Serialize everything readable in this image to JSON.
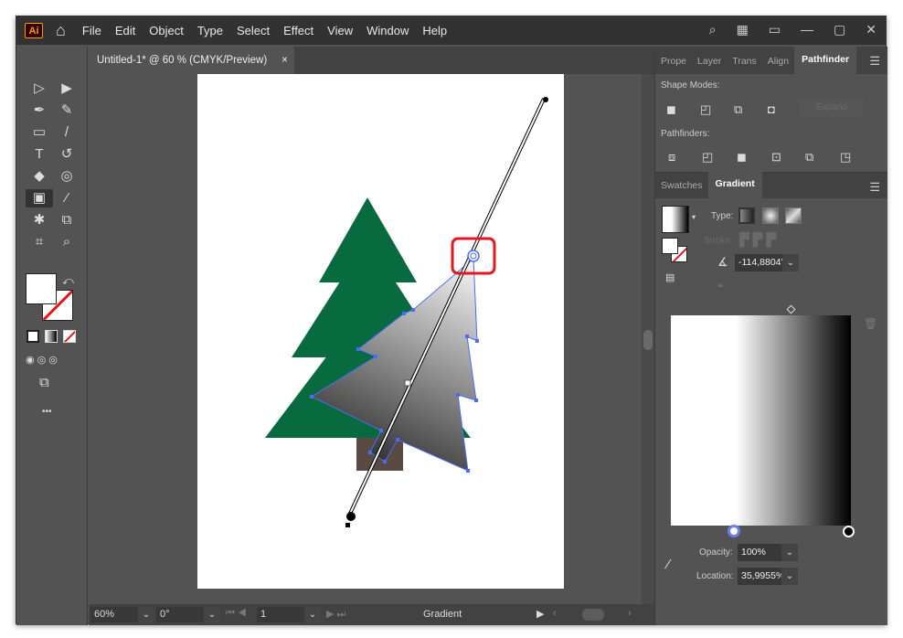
{
  "app": {
    "logo": "Ai",
    "home_icon": "home-icon"
  },
  "menu": [
    "File",
    "Edit",
    "Object",
    "Type",
    "Select",
    "Effect",
    "View",
    "Window",
    "Help"
  ],
  "document_tab": {
    "title": "Untitled-1* @ 60 % (CMYK/Preview)",
    "close": "×"
  },
  "status": {
    "zoom": "60%",
    "rotation": "0°",
    "artboard": "1",
    "tool": "Gradient"
  },
  "panel1": {
    "tabs": [
      "Prope",
      "Layer",
      "Trans",
      "Align",
      "Pathfinder"
    ],
    "active": "Pathfinder",
    "shape_modes_label": "Shape Modes:",
    "expand_label": "Expand",
    "pathfinders_label": "Pathfinders:"
  },
  "panel2": {
    "tabs": [
      "Swatches",
      "Gradient"
    ],
    "active": "Gradient",
    "type_label": "Type:",
    "stroke_label": "Stroke:",
    "angle": "-114,8804°",
    "opacity_label": "Opacity:",
    "opacity": "100%",
    "location_label": "Location:",
    "location": "35,9955%"
  },
  "gradient": {
    "stops": [
      {
        "color": "#ffffff",
        "location": 35.9955
      },
      {
        "color": "#000000",
        "location": 100
      }
    ]
  },
  "colors": {
    "tree": "#086b3f",
    "trunk": "#5a4a44",
    "highlight": "#e8161c",
    "selection": "#4a6cf7"
  },
  "toolbar_more": "•••"
}
